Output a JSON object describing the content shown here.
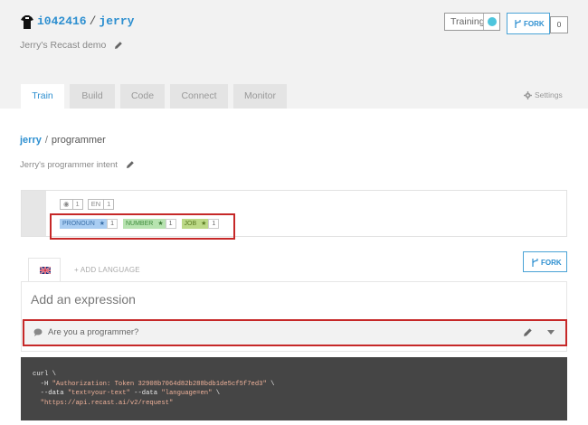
{
  "header": {
    "owner": "i042416",
    "separator": "/",
    "bot_name": "jerry",
    "description": "Jerry's Recast demo",
    "training_label": "Training",
    "fork_label": "FORK",
    "fork_count": "0",
    "status_color": "#4ec5dd"
  },
  "tabs": [
    {
      "label": "Train",
      "active": true
    },
    {
      "label": "Build",
      "active": false
    },
    {
      "label": "Code",
      "active": false
    },
    {
      "label": "Connect",
      "active": false
    },
    {
      "label": "Monitor",
      "active": false
    }
  ],
  "settings_label": "Settings",
  "breadcrumb": {
    "owner": "jerry",
    "separator": "/",
    "intent": "programmer"
  },
  "intent_description": "Jerry's programmer intent",
  "intent_meta": {
    "expressions_count": "1",
    "lang": "EN",
    "lang_count": "1"
  },
  "entities": [
    {
      "name": "PRONOUN",
      "count": "1",
      "color": "#a9cdf2"
    },
    {
      "name": "NUMBER",
      "count": "1",
      "color": "#b7e3b0"
    },
    {
      "name": "JOB",
      "count": "1",
      "color": "#bcd987"
    }
  ],
  "language_tab": {
    "icon": "uk-flag-icon"
  },
  "add_language_label": "+ ADD LANGUAGE",
  "fork_button_label": "FORK",
  "expression_input": {
    "placeholder": "Add an expression",
    "value": ""
  },
  "expressions": [
    {
      "text": "Are you a programmer?"
    }
  ],
  "code_snippet": {
    "line1": "curl \\",
    "line2_flag": "  -H ",
    "line2_value": "\"Authorization: Token 32908b7064d82b288bdb1de5cf5f7ed3\"",
    "line2_end": " \\",
    "line3_flag1": "  --data ",
    "line3_value1": "\"text=your-text\"",
    "line3_flag2": " --data ",
    "line3_value2": "\"language=en\"",
    "line3_end": " \\",
    "line4_value": "  \"https://api.recast.ai/v2/request\""
  },
  "accent_color": "#2d8fd0",
  "highlight_color": "#c62828"
}
